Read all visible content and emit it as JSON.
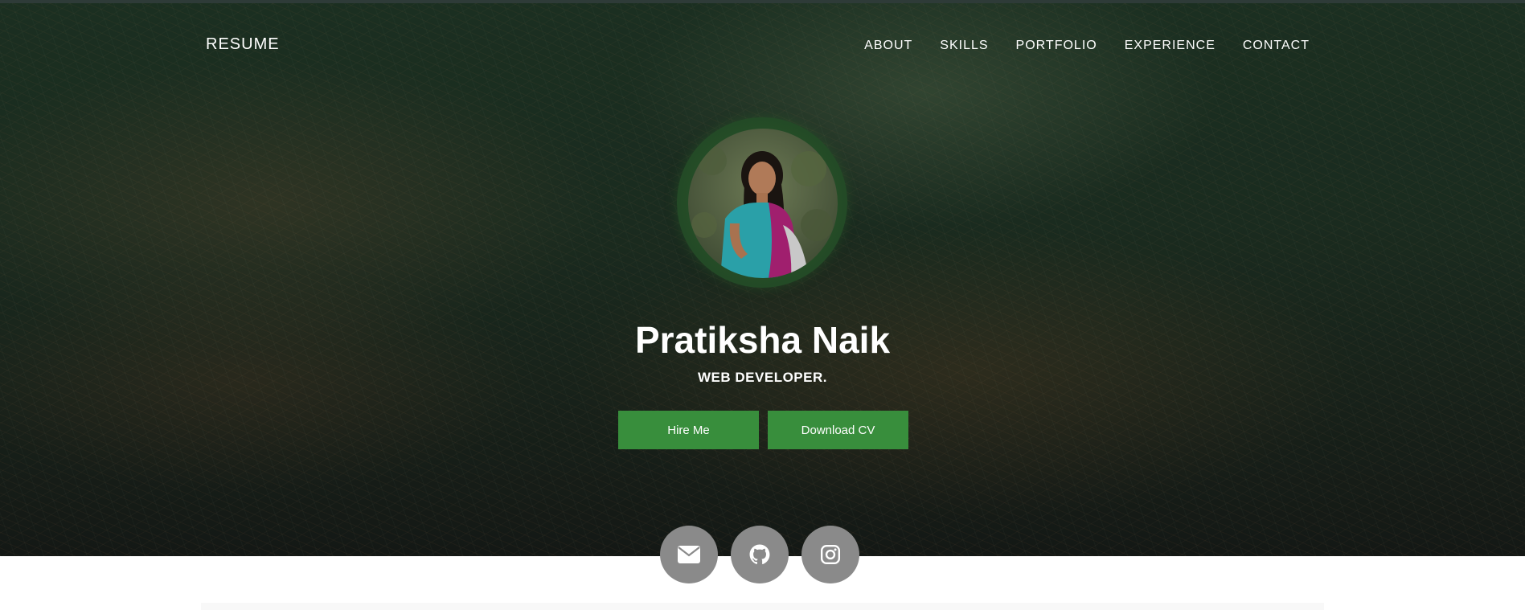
{
  "nav": {
    "logo": "RESUME",
    "links": [
      {
        "label": "ABOUT"
      },
      {
        "label": "SKILLS"
      },
      {
        "label": "PORTFOLIO"
      },
      {
        "label": "EXPERIENCE"
      },
      {
        "label": "CONTACT"
      }
    ]
  },
  "hero": {
    "name": "Pratiksha Naik",
    "role": "WEB DEVELOPER.",
    "hire_label": "Hire Me",
    "download_label": "Download CV"
  },
  "social": [
    {
      "icon": "envelope-icon"
    },
    {
      "icon": "github-icon"
    },
    {
      "icon": "instagram-icon"
    }
  ],
  "colors": {
    "accent": "#388e3c",
    "social_bg": "#8a8a8a",
    "hero_bg": "#1a2b1f"
  }
}
